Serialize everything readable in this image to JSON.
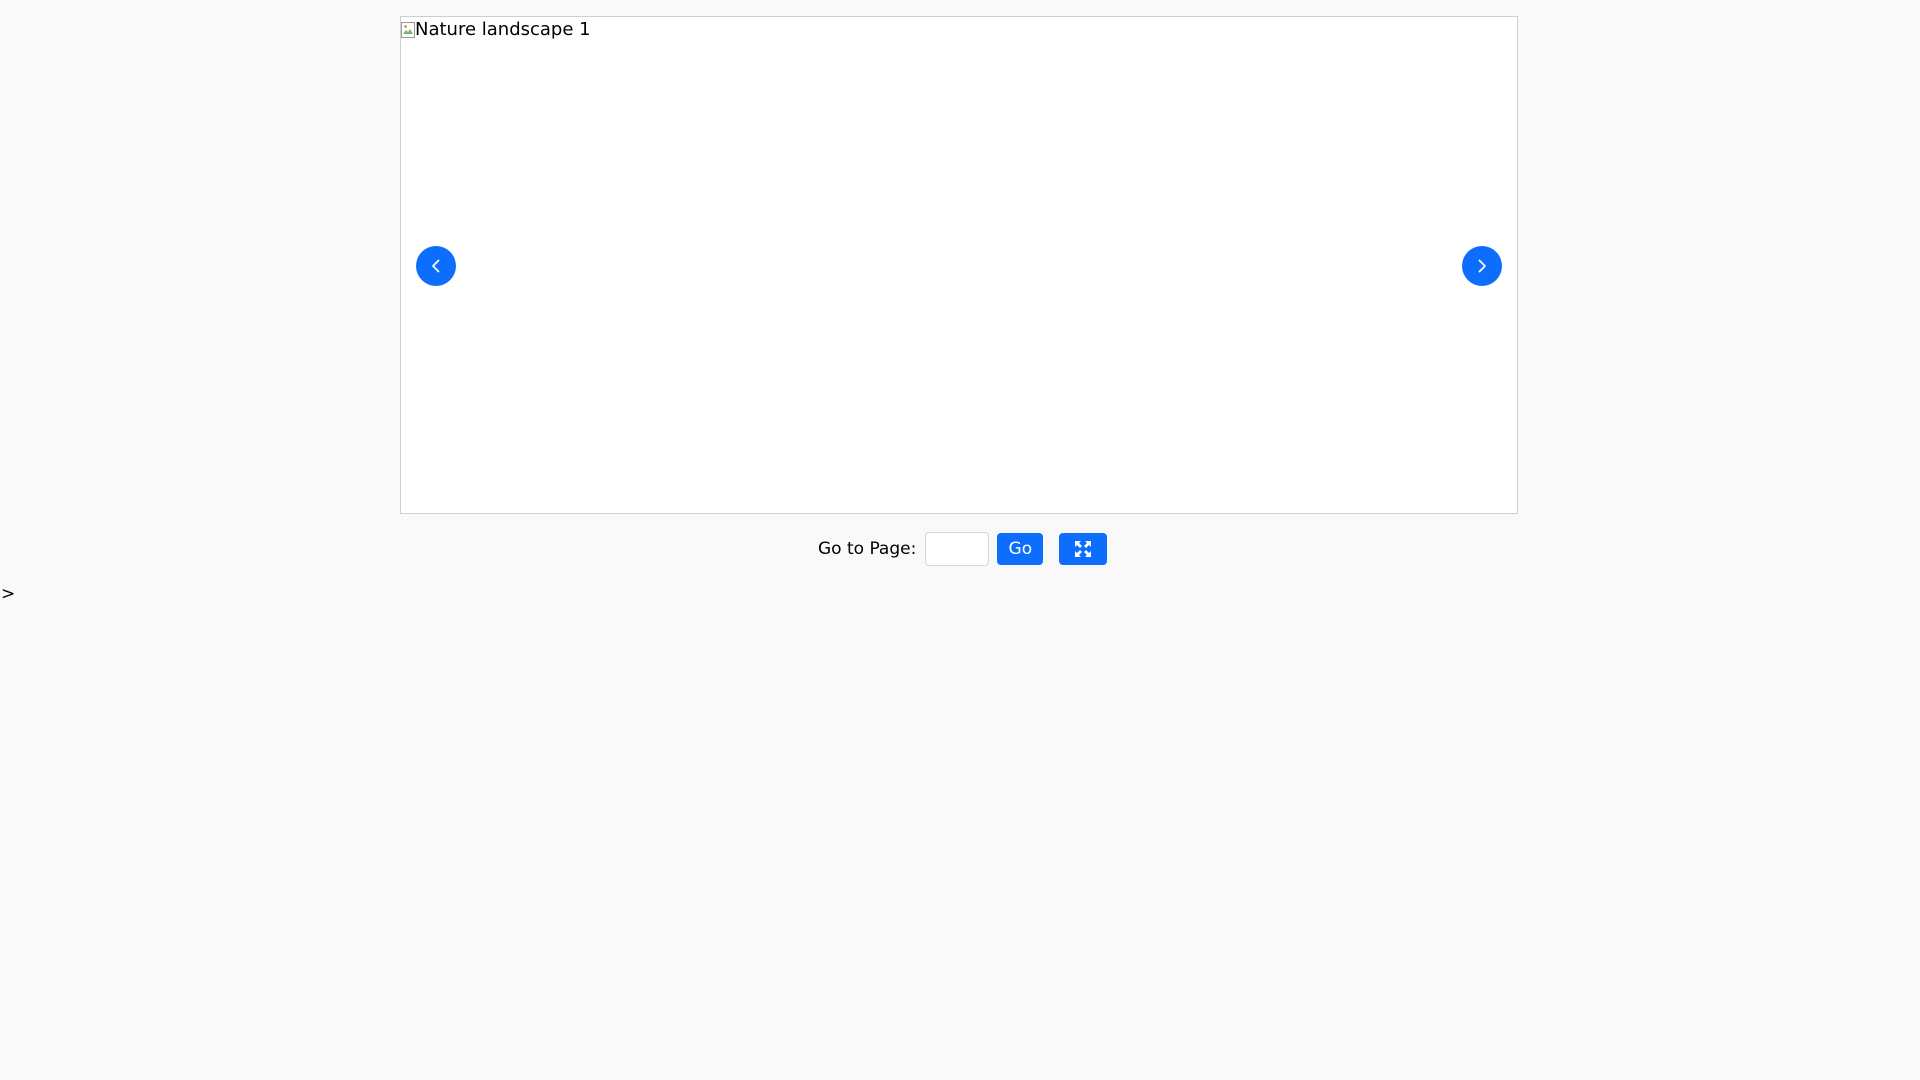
{
  "slideshow": {
    "image_alt": "Nature landscape 1",
    "prev_icon": "chevron-left-icon",
    "next_icon": "chevron-right-icon"
  },
  "controls": {
    "goto_label": "Go to Page:",
    "page_input_value": "",
    "go_label": "Go",
    "fullscreen_icon": "fullscreen-icon"
  },
  "stray_text": ">",
  "colors": {
    "accent": "#0d6efd",
    "background": "#f9f9f9",
    "viewer_background": "#ffffff",
    "viewer_border": "#cfcfcf"
  }
}
